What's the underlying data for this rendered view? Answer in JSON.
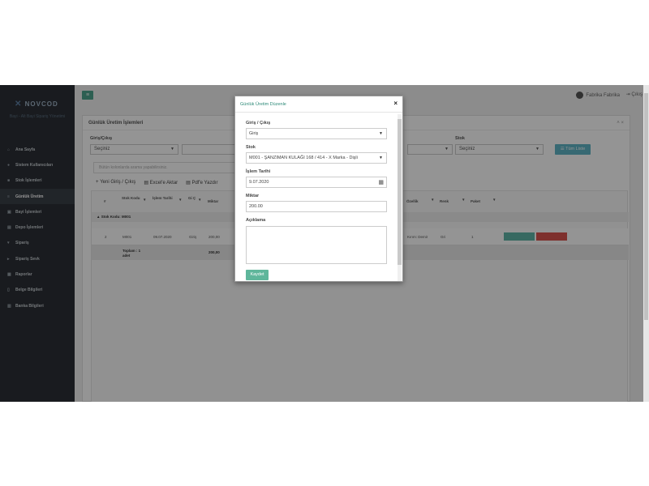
{
  "app": {
    "logo_text": "NOVCOD",
    "brand_sub": "Bayi - Alt Bayi Sipariş Yönetimi",
    "menu_icon": "bars-icon"
  },
  "sidebar": {
    "items": [
      {
        "label": "Ana Sayfa",
        "icon": "home-icon"
      },
      {
        "label": "Sistem Kullanıcıları",
        "icon": "users-icon"
      },
      {
        "label": "Stok İşlemleri",
        "icon": "box-icon"
      },
      {
        "label": "Günlük Üretim",
        "icon": "list-icon",
        "active": true
      },
      {
        "label": "Bayi İşlemleri",
        "icon": "store-icon"
      },
      {
        "label": "Depo İşlemleri",
        "icon": "warehouse-icon"
      },
      {
        "label": "Sipariş",
        "icon": "cart-icon"
      },
      {
        "label": "Sipariş Sevk",
        "icon": "truck-icon"
      },
      {
        "label": "Raporlar",
        "icon": "report-icon"
      },
      {
        "label": "Belge Bilgileri",
        "icon": "file-icon"
      },
      {
        "label": "Banka Bilgileri",
        "icon": "bank-icon"
      }
    ]
  },
  "header": {
    "user_name": "Fabrika Fabrika",
    "logout_label": "Çıkış"
  },
  "panel": {
    "title": "Günlük Üretim İşlemleri",
    "filters": {
      "giris_cikis_label": "Giriş/Çıkış",
      "giris_cikis_value": "Seçiniz",
      "stok_label": "Stok",
      "stok_value": "Seçiniz"
    },
    "list_button": "Tüm Liste",
    "search_placeholder": "Bütün kolonlarda arama yapabilirsiniz.",
    "actions": {
      "new": "Yeni Giriş / Çıkış",
      "excel": "Excel'e Aktar",
      "pdf": "Pdf'e Yazdır"
    },
    "table": {
      "headers": [
        "#",
        "Stok Kodu",
        "İşlem Tarihi",
        "Gi Ç",
        "Miktar",
        "Özellik",
        "Renk",
        "Paket"
      ],
      "group_label": "Stok Kodu: M001",
      "row": {
        "no": "2",
        "stok_kodu": "M001",
        "tarih": "09.07.2020",
        "giris": "Giriş",
        "miktar": "200,00",
        "ozellik": "Kırım: Demir",
        "renk": "Gri",
        "paket": "1",
        "edit_label": "Güncelle",
        "delete_label": "Sil"
      },
      "total_label": "Toplam : 1 adet",
      "total_value": "200,00"
    }
  },
  "modal": {
    "title": "Günlük Üretim Düzenle",
    "close": "×",
    "giris_cikis_label": "Giriş / Çıkış",
    "giris_cikis_value": "Giriş",
    "stok_label": "Stok",
    "stok_value": "M001 - ŞANZIMAN KULAĞI 168 / 414 - X Marka - Dişli",
    "tarih_label": "İşlem Tarihi",
    "tarih_value": "9.07.2020",
    "miktar_label": "Miktar",
    "miktar_value": "200.00",
    "aciklama_label": "Açıklama",
    "aciklama_value": "",
    "save_label": "Kaydet"
  }
}
